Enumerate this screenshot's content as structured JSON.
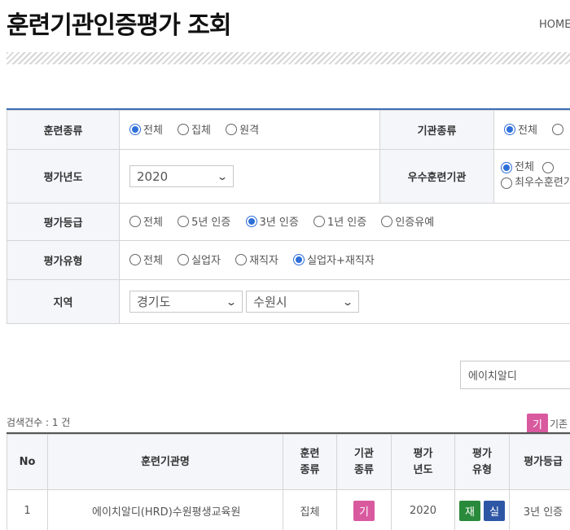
{
  "header": {
    "title": "훈련기관인증평가 조회",
    "home_label": "HOME"
  },
  "filters": {
    "training_type": {
      "label": "훈련종류",
      "options": [
        {
          "label": "전체",
          "selected": true
        },
        {
          "label": "집체",
          "selected": false
        },
        {
          "label": "원격",
          "selected": false
        }
      ]
    },
    "institution_type": {
      "label": "기관종류",
      "options": [
        {
          "label": "전체",
          "selected": true
        },
        {
          "label": "",
          "selected": false
        }
      ]
    },
    "eval_year": {
      "label": "평가년도",
      "value": "2020"
    },
    "excellent_institution": {
      "label": "우수훈련기관",
      "options": [
        {
          "label": "전체",
          "selected": true
        },
        {
          "label": "",
          "selected": false
        },
        {
          "label": "최우수훈련기",
          "selected": false
        }
      ]
    },
    "eval_grade": {
      "label": "평가등급",
      "options": [
        {
          "label": "전체",
          "selected": false
        },
        {
          "label": "5년 인증",
          "selected": false
        },
        {
          "label": "3년 인증",
          "selected": true
        },
        {
          "label": "1년 인증",
          "selected": false
        },
        {
          "label": "인증유예",
          "selected": false
        }
      ]
    },
    "eval_type": {
      "label": "평가유형",
      "options": [
        {
          "label": "전체",
          "selected": false
        },
        {
          "label": "실업자",
          "selected": false
        },
        {
          "label": "재직자",
          "selected": false
        },
        {
          "label": "실업자+재직자",
          "selected": true
        }
      ]
    },
    "region": {
      "label": "지역",
      "province": "경기도",
      "city": "수원시"
    }
  },
  "search": {
    "value": "에이치알디"
  },
  "results": {
    "count_text": "검색건수 : 1 건",
    "legend": {
      "badge": "기",
      "text": "기존"
    },
    "columns": {
      "no": "No",
      "name": "훈련기관명",
      "training_type_1": "훈련",
      "training_type_2": "종류",
      "inst_type_1": "기관",
      "inst_type_2": "종류",
      "eval_year_1": "평가",
      "eval_year_2": "년도",
      "eval_type_1": "평가",
      "eval_type_2": "유형",
      "grade": "평가등급"
    },
    "rows": [
      {
        "no": "1",
        "name": "에이치알디(HRD)수원평생교육원",
        "training_type": "집체",
        "inst_type_badge": "기",
        "eval_year": "2020",
        "eval_type_badges": [
          "재",
          "실"
        ],
        "grade": "3년 인증"
      }
    ]
  },
  "colors": {
    "accent_blue": "#3b6db5",
    "radio_selected": "#2e6fd9",
    "badge_pink": "#d9599f",
    "badge_green": "#2a8a3b",
    "badge_blue": "#2d56a5"
  }
}
